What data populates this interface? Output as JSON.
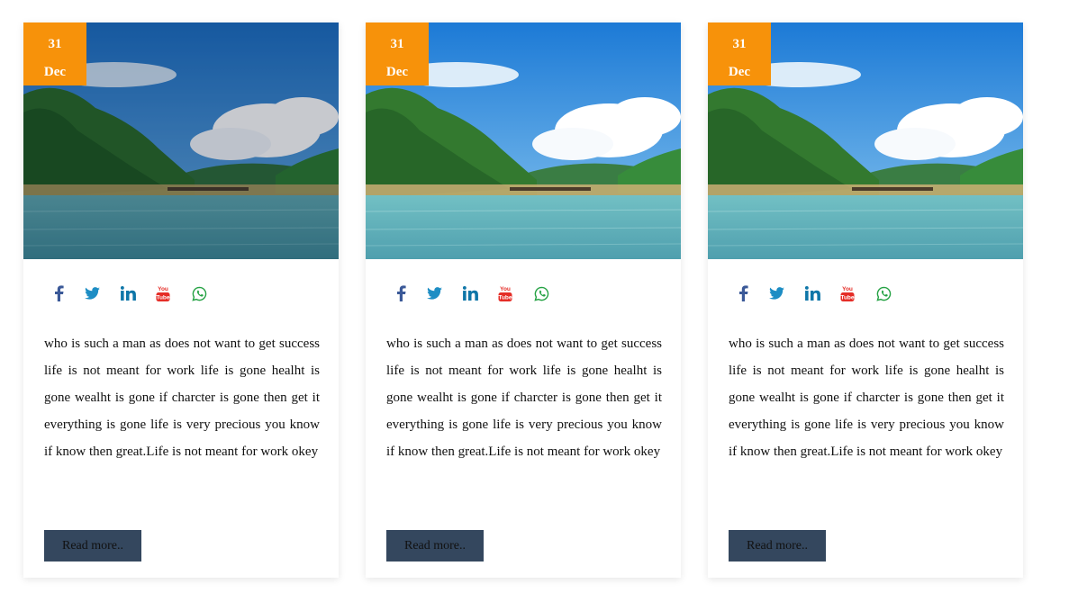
{
  "cards": [
    {
      "date": {
        "day": "31",
        "month": "Dec"
      },
      "text": "who is such a man as does not want to get success life is not meant for work life is gone healht is gone wealht is gone if charcter is gone then get it everything is gone life is very precious you know if know then great.Life is not meant for work okey",
      "button": "Read more.."
    },
    {
      "date": {
        "day": "31",
        "month": "Dec"
      },
      "text": "who is such a man as does not want to get success life is not meant for work life is gone healht is gone wealht is gone if charcter is gone then get it everything is gone life is very precious you know if know then great.Life is not meant for work okey",
      "button": "Read more.."
    },
    {
      "date": {
        "day": "31",
        "month": "Dec"
      },
      "text": "who is such a man as does not want to get success life is not meant for work life is gone healht is gone wealht is gone if charcter is gone then get it everything is gone life is very precious you know if know then great.Life is not meant for work okey",
      "button": "Read more.."
    }
  ],
  "social_icons": [
    "facebook-icon",
    "twitter-icon",
    "linkedin-icon",
    "youtube-icon",
    "whatsapp-icon"
  ],
  "colors": {
    "date_badge": "#f7920a",
    "button": "#34475e",
    "facebook": "#3b5998",
    "twitter": "#1d8dc4",
    "linkedin": "#0e76a8",
    "youtube": "#e52d27",
    "whatsapp": "#25a244"
  }
}
